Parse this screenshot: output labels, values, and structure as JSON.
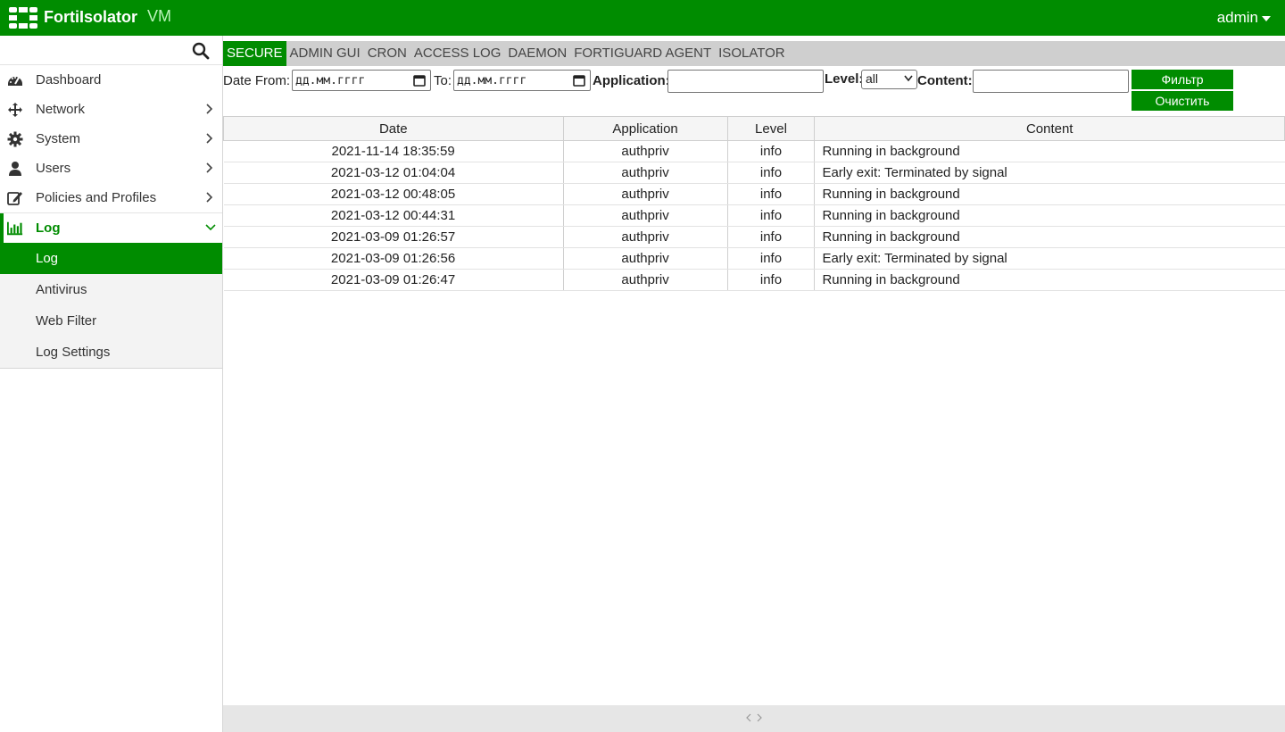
{
  "header": {
    "brand": "FortiIsolator",
    "edition": "VM",
    "user": "admin",
    "accent": "#008c00"
  },
  "sidebar": {
    "items": [
      {
        "label": "Dashboard",
        "icon": "dashboard-icon"
      },
      {
        "label": "Network",
        "icon": "network-icon"
      },
      {
        "label": "System",
        "icon": "gear-icon"
      },
      {
        "label": "Users",
        "icon": "user-icon"
      },
      {
        "label": "Policies and Profiles",
        "icon": "edit-icon"
      }
    ],
    "log_group": {
      "label": "Log",
      "icon": "bar-chart-icon",
      "children": [
        "Log",
        "Antivirus",
        "Web Filter",
        "Log Settings"
      ]
    }
  },
  "tabs": [
    "SECURE",
    "ADMIN GUI",
    "CRON",
    "ACCESS LOG",
    "DAEMON",
    "FORTIGUARD AGENT",
    "ISOLATOR"
  ],
  "filters": {
    "date_from_label": "Date From:",
    "date_from_value": "дд.мм.гггг",
    "to_label": "To:",
    "to_value": "дд.мм.гггг",
    "application_label": "Application:",
    "level_label": "Level:",
    "level_value": "all",
    "content_label": "Content:",
    "filter_button": "Фильтр",
    "clear_button": "Очистить"
  },
  "table": {
    "columns": [
      "Date",
      "Application",
      "Level",
      "Content"
    ],
    "rows": [
      [
        "2021-11-14 18:35:59",
        "authpriv",
        "info",
        "Running in background"
      ],
      [
        "2021-03-12 01:04:04",
        "authpriv",
        "info",
        "Early exit: Terminated by signal"
      ],
      [
        "2021-03-12 00:48:05",
        "authpriv",
        "info",
        "Running in background"
      ],
      [
        "2021-03-12 00:44:31",
        "authpriv",
        "info",
        "Running in background"
      ],
      [
        "2021-03-09 01:26:57",
        "authpriv",
        "info",
        "Running in background"
      ],
      [
        "2021-03-09 01:26:56",
        "authpriv",
        "info",
        "Early exit: Terminated by signal"
      ],
      [
        "2021-03-09 01:26:47",
        "authpriv",
        "info",
        "Running in background"
      ]
    ]
  }
}
